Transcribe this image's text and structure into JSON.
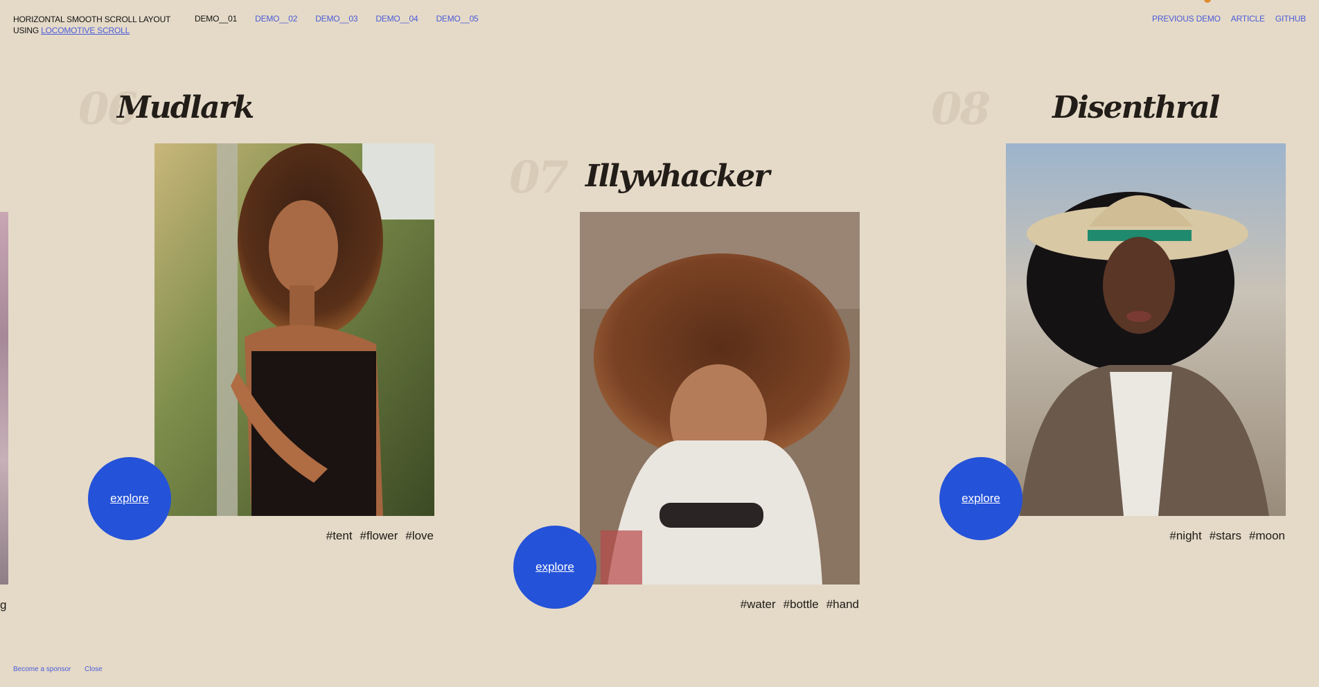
{
  "header": {
    "title_line1": "HORIZONTAL SMOOTH SCROLL LAYOUT",
    "title_prefix": "USING ",
    "title_lib": "LOCOMOTIVE SCROLL",
    "demos": [
      "DEMO__01",
      "DEMO__02",
      "DEMO__03",
      "DEMO__04",
      "DEMO__05"
    ],
    "links": [
      "PREVIOUS DEMO",
      "ARTICLE",
      "GITHUB"
    ]
  },
  "items": [
    {
      "number": "06",
      "title": "Mudlark",
      "explore": "explore",
      "tags": [
        "#tent",
        "#flower",
        "#love"
      ]
    },
    {
      "number": "07",
      "title": "Illywhacker",
      "explore": "explore",
      "tags": [
        "#water",
        "#bottle",
        "#hand"
      ]
    },
    {
      "number": "08",
      "title": "Disenthral",
      "explore": "explore",
      "tags": [
        "#night",
        "#stars",
        "#moon"
      ]
    }
  ],
  "partial_left_tag": "g",
  "footer": {
    "sponsor": "Become a sponsor",
    "close": "Close"
  },
  "colors": {
    "background": "#e5dac8",
    "accent": "#2452d8",
    "link": "#4a5bd8"
  }
}
